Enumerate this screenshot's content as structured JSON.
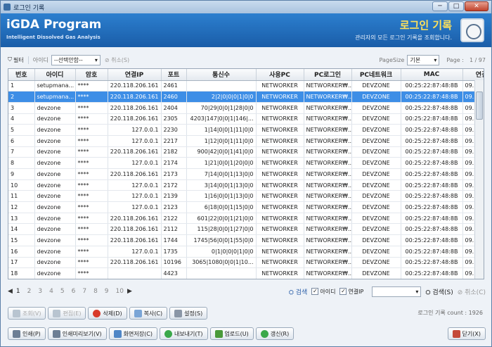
{
  "window": {
    "title": "로그인 기록",
    "min": "─",
    "max": "□",
    "close": "✕"
  },
  "banner": {
    "app_title": "iGDA Program",
    "app_sub": "Intelligent Dissolved Gas Analysis",
    "page_title": "로그인 기록",
    "page_desc": "관리자의 모든 로그인 기록을 조회합니다."
  },
  "filter": {
    "filter_label": "필터",
    "id_label": "아이디",
    "id_select": "--선택안함--",
    "cancel_label": "취소(S)",
    "pagesize_label": "PageSize",
    "pagesize_value": "기본",
    "page_label": "Page :",
    "page_value": "1 / 97"
  },
  "grid": {
    "headers": [
      "번호",
      "아이디",
      "암호",
      "연결IP",
      "포트",
      "통신수",
      "사용PC",
      "PC로그인",
      "PC네트워크",
      "MAC",
      "연결"
    ],
    "rows": [
      [
        "1",
        "setupmana...",
        "****",
        "220.118.206.161",
        "2461",
        "",
        "NETWORKER",
        "NETWORKER₩...",
        "DEVZONE",
        "00:25:22:87:48:8B",
        "09."
      ],
      [
        "2",
        "setupmana...",
        "****",
        "220.118.206.161",
        "2460",
        "2|2|0|0|0|1|0|0",
        "NETWORKER",
        "NETWORKER₩...",
        "DEVZONE",
        "00:25:22:87:48:8B",
        "09."
      ],
      [
        "3",
        "devzone",
        "****",
        "220.118.206.161",
        "2404",
        "70|29|0|0|1|28|0|0",
        "NETWORKER",
        "NETWORKER₩...",
        "DEVZONE",
        "00:25:22:87:48:8B",
        "09."
      ],
      [
        "4",
        "devzone",
        "****",
        "220.118.206.161",
        "2305",
        "4203|147|0|0|1|146|...",
        "NETWORKER",
        "NETWORKER₩...",
        "DEVZONE",
        "00:25:22:87:48:8B",
        "09."
      ],
      [
        "5",
        "devzone",
        "****",
        "127.0.0.1",
        "2230",
        "1|14|0|0|1|11|0|0",
        "NETWORKER",
        "NETWORKER₩...",
        "DEVZONE",
        "00:25:22:87:48:8B",
        "09."
      ],
      [
        "6",
        "devzone",
        "****",
        "127.0.0.1",
        "2217",
        "1|12|0|0|1|11|0|0",
        "NETWORKER",
        "NETWORKER₩...",
        "DEVZONE",
        "00:25:22:87:48:8B",
        "09."
      ],
      [
        "7",
        "devzone",
        "****",
        "220.118.206.161",
        "2182",
        "900|42|0|0|1|41|0|0",
        "NETWORKER",
        "NETWORKER₩...",
        "DEVZONE",
        "00:25:22:87:48:8B",
        "09."
      ],
      [
        "8",
        "devzone",
        "****",
        "127.0.0.1",
        "2174",
        "1|21|0|0|1|20|0|0",
        "NETWORKER",
        "NETWORKER₩...",
        "DEVZONE",
        "00:25:22:87:48:8B",
        "09."
      ],
      [
        "9",
        "devzone",
        "****",
        "220.118.206.161",
        "2173",
        "7|14|0|0|1|13|0|0",
        "NETWORKER",
        "NETWORKER₩...",
        "DEVZONE",
        "00:25:22:87:48:8B",
        "09."
      ],
      [
        "10",
        "devzone",
        "****",
        "127.0.0.1",
        "2172",
        "3|14|0|0|1|13|0|0",
        "NETWORKER",
        "NETWORKER₩...",
        "DEVZONE",
        "00:25:22:87:48:8B",
        "09."
      ],
      [
        "11",
        "devzone",
        "****",
        "127.0.0.1",
        "2139",
        "1|16|0|0|1|13|0|0",
        "NETWORKER",
        "NETWORKER₩...",
        "DEVZONE",
        "00:25:22:87:48:8B",
        "09."
      ],
      [
        "12",
        "devzone",
        "****",
        "127.0.0.1",
        "2123",
        "6|18|0|0|1|15|0|0",
        "NETWORKER",
        "NETWORKER₩...",
        "DEVZONE",
        "00:25:22:87:48:8B",
        "09."
      ],
      [
        "13",
        "devzone",
        "****",
        "220.118.206.161",
        "2122",
        "601|22|0|0|1|21|0|0",
        "NETWORKER",
        "NETWORKER₩...",
        "DEVZONE",
        "00:25:22:87:48:8B",
        "09."
      ],
      [
        "14",
        "devzone",
        "****",
        "220.118.206.161",
        "2112",
        "115|28|0|0|1|27|0|0",
        "NETWORKER",
        "NETWORKER₩...",
        "DEVZONE",
        "00:25:22:87:48:8B",
        "09."
      ],
      [
        "15",
        "devzone",
        "****",
        "220.118.206.161",
        "1744",
        "1745|56|0|0|1|55|0|0",
        "NETWORKER",
        "NETWORKER₩...",
        "DEVZONE",
        "00:25:22:87:48:8B",
        "09."
      ],
      [
        "16",
        "devzone",
        "****",
        "127.0.0.1",
        "1735",
        "0|1|0|0|0|1|0|0",
        "NETWORKER",
        "NETWORKER₩...",
        "DEVZONE",
        "00:25:22:87:48:8B",
        "09."
      ],
      [
        "17",
        "devzone",
        "****",
        "220.118.206.161",
        "10196",
        "3065|1080|0|0|1|10...",
        "NETWORKER",
        "NETWORKER₩...",
        "DEVZONE",
        "00:25:22:87:48:8B",
        "09."
      ],
      [
        "18",
        "devzone",
        "****",
        "",
        "4423",
        "",
        "NETWORKER",
        "NETWORKER₩...",
        "DEVZONE",
        "00:25:22:87:48:8B",
        "09."
      ]
    ]
  },
  "pager": {
    "pages": [
      "1",
      "2",
      "3",
      "4",
      "5",
      "6",
      "7",
      "8",
      "9",
      "10"
    ],
    "search_label": "검색",
    "chk_id": "아이디",
    "chk_ip": "연결IP",
    "search_btn": "검색(S)",
    "cancel_btn": "취소(C)"
  },
  "actions": {
    "view": "조회(V)",
    "edit": "편집(E)",
    "delete": "삭제(D)",
    "copy": "복사(C)",
    "settings": "설정(S)",
    "count": "로그인 기록 count : 1926"
  },
  "bottom": {
    "print": "인쇄(P)",
    "preview": "인쇄미리보기(V)",
    "save_screen": "화면저장(C)",
    "export": "내보내기(T)",
    "upload": "업로드(U)",
    "refresh": "갱신(R)",
    "close": "닫기(X)"
  }
}
